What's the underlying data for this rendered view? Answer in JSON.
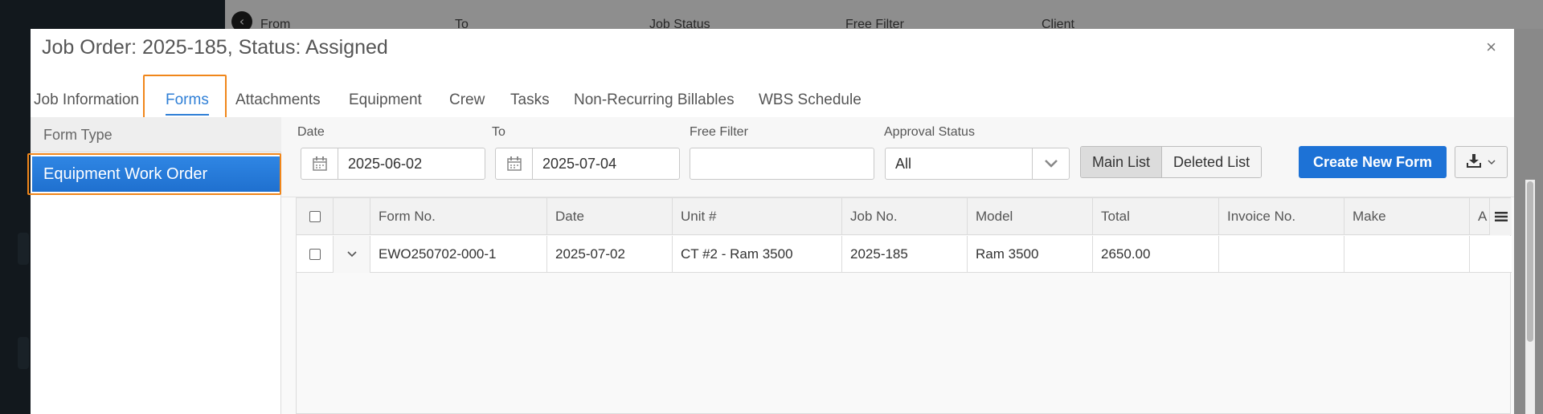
{
  "background": {
    "filter_labels": [
      "From",
      "To",
      "Job Status",
      "Free Filter",
      "Client"
    ]
  },
  "modal": {
    "title": "Job Order: 2025-185, Status: Assigned",
    "close_icon": "×"
  },
  "tabs": [
    {
      "label": "Job Information"
    },
    {
      "label": "Forms",
      "active": true
    },
    {
      "label": "Attachments"
    },
    {
      "label": "Equipment"
    },
    {
      "label": "Crew"
    },
    {
      "label": "Tasks"
    },
    {
      "label": "Non-Recurring Billables"
    },
    {
      "label": "WBS Schedule"
    }
  ],
  "left_panel": {
    "header": "Form Type",
    "items": [
      {
        "label": "Equipment Work Order",
        "selected": true
      }
    ]
  },
  "filters": {
    "date_label": "Date",
    "date_from": "2025-06-02",
    "to_label": "To",
    "date_to": "2025-07-04",
    "free_filter_label": "Free Filter",
    "free_filter_value": "",
    "approval_label": "Approval Status",
    "approval_value": "All",
    "main_list": "Main List",
    "deleted_list": "Deleted List",
    "create_button": "Create New Form"
  },
  "table": {
    "columns": [
      "Form No.",
      "Date",
      "Unit #",
      "Job No.",
      "Model",
      "Total",
      "Invoice No.",
      "Make",
      "A"
    ],
    "rows": [
      {
        "cells": [
          "EWO250702-000-1",
          "2025-07-02",
          "CT #2 - Ram 3500",
          "2025-185",
          "Ram 3500",
          "2650.00",
          "",
          "",
          ""
        ]
      }
    ]
  },
  "colors": {
    "accent": "#2f7fd6",
    "primary_button": "#1d72d6",
    "highlight": "#f0861a"
  },
  "icons": {
    "calendar": "calendar-icon",
    "dropdown": "chevron-down-icon",
    "export": "download-icon",
    "menu": "hamburger-menu-icon",
    "back": "back-arrow-icon"
  }
}
